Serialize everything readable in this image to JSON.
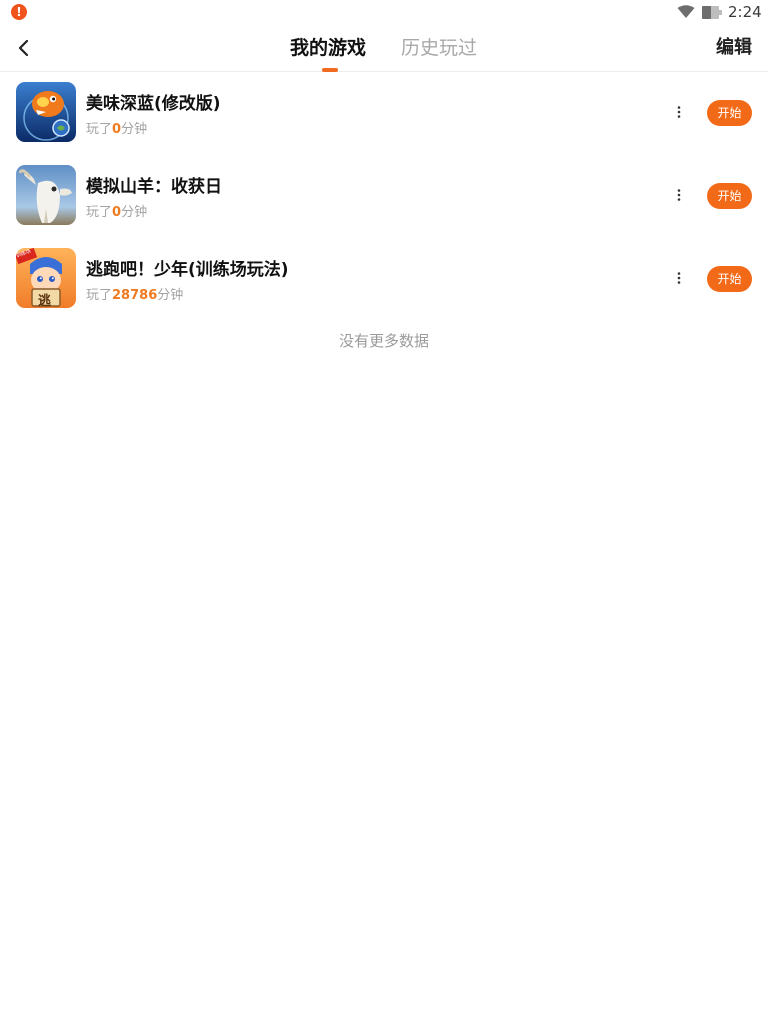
{
  "status_bar": {
    "time": "2:24",
    "alert_glyph": "!",
    "alert_color": "#f0531c"
  },
  "header": {
    "tabs": [
      {
        "label": "我的游戏",
        "active": true
      },
      {
        "label": "历史玩过",
        "active": false
      }
    ],
    "edit_label": "编辑",
    "accent_color": "#f06a1f"
  },
  "games": [
    {
      "title": "美味深蓝(修改版)",
      "played_prefix": "玩了",
      "minutes": "0",
      "minutes_unit": "分钟",
      "start_label": "开始",
      "icon": "fish-game-icon"
    },
    {
      "title": "模拟山羊：收获日",
      "played_prefix": "玩了",
      "minutes": "0",
      "minutes_unit": "分钟",
      "start_label": "开始",
      "icon": "goat-game-icon"
    },
    {
      "title": "逃跑吧！少年(训练场玩法)",
      "played_prefix": "玩了",
      "minutes": "28786",
      "minutes_unit": "分钟",
      "start_label": "开始",
      "icon": "escape-boy-game-icon",
      "icon_badge": "训练场",
      "icon_sign": "逃"
    }
  ],
  "footer": {
    "no_more_text": "没有更多数据"
  }
}
